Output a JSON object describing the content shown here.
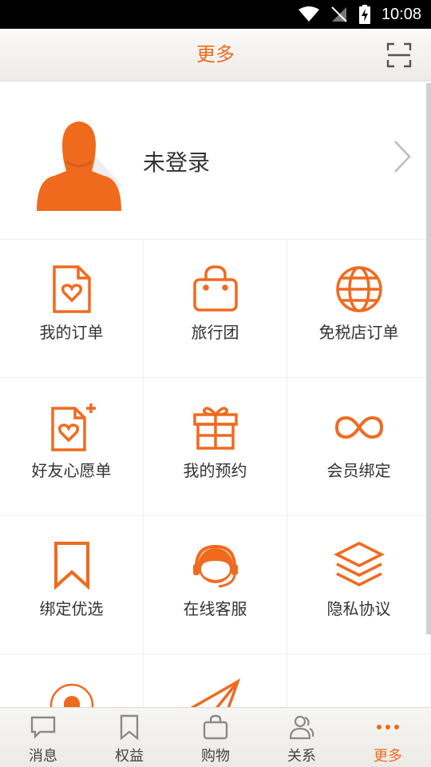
{
  "status_bar": {
    "time": "10:08"
  },
  "header": {
    "title": "更多"
  },
  "profile": {
    "name": "未登录"
  },
  "menu": [
    {
      "label": "我的订单"
    },
    {
      "label": "旅行团"
    },
    {
      "label": "免税店订单"
    },
    {
      "label": "好友心愿单"
    },
    {
      "label": "我的预约"
    },
    {
      "label": "会员绑定"
    },
    {
      "label": "绑定优选"
    },
    {
      "label": "在线客服"
    },
    {
      "label": "隐私协议"
    }
  ],
  "tabs": [
    {
      "label": "消息"
    },
    {
      "label": "权益"
    },
    {
      "label": "购物"
    },
    {
      "label": "关系"
    },
    {
      "label": "更多"
    }
  ],
  "active_tab": "更多",
  "colors": {
    "accent": "#f06a1e",
    "text": "#333333",
    "tab_inactive": "#8a8a8a"
  }
}
